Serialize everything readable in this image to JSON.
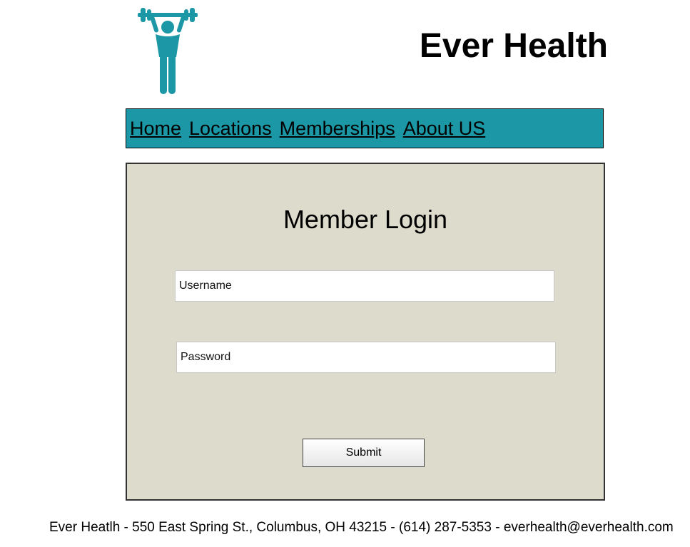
{
  "colors": {
    "nav_background": "#1b97a5",
    "panel_background": "#dddbcc",
    "logo_color": "#1b97a5"
  },
  "header": {
    "logo_icon": "weightlifter-icon",
    "title": "Ever Health"
  },
  "nav": {
    "items": [
      {
        "label": "Home"
      },
      {
        "label": "Locations"
      },
      {
        "label": "Memberships"
      },
      {
        "label": "About US"
      }
    ]
  },
  "login": {
    "title": "Member Login",
    "username_placeholder": "Username",
    "username_value": "",
    "password_placeholder": "Password",
    "password_value": "",
    "submit_label": "Submit"
  },
  "footer": {
    "text": "Ever Heatlh - 550 East Spring St., Columbus, OH 43215 - (614) 287-5353 - everhealth@everhealth.com"
  }
}
